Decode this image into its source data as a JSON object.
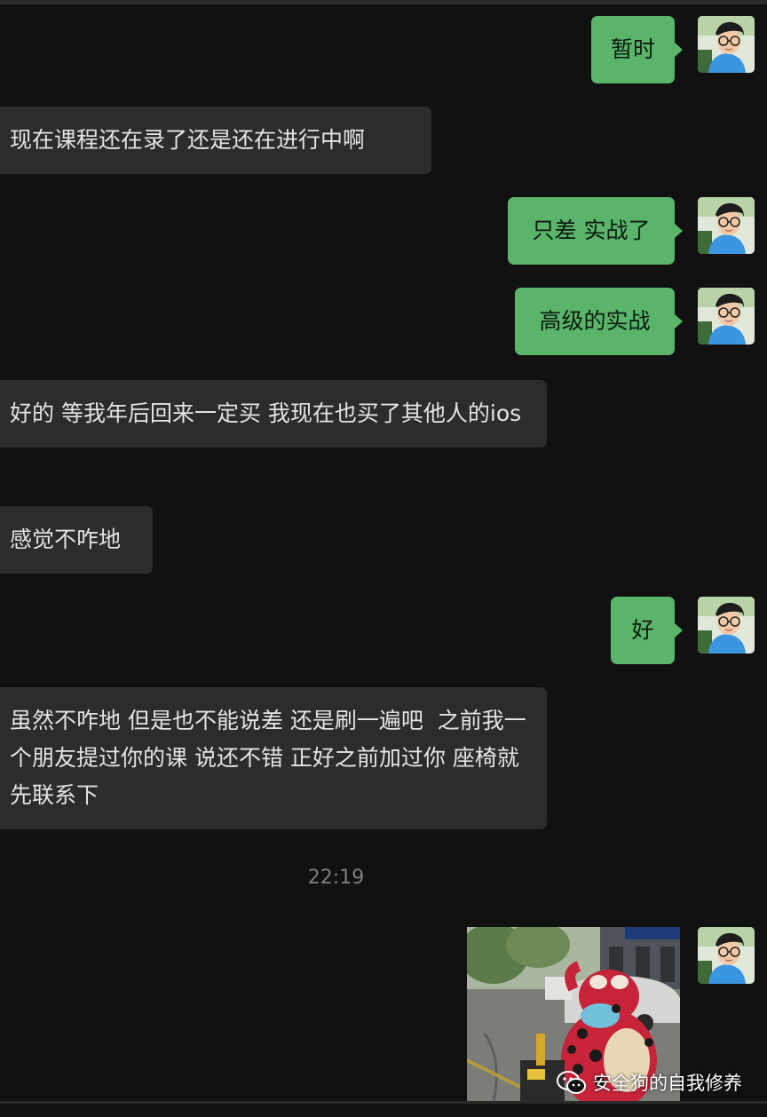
{
  "messages": [
    {
      "side": "out",
      "text": "暂时"
    },
    {
      "side": "in",
      "text": "现在课程还在录了还是还在进行中啊"
    },
    {
      "side": "out",
      "text": "只差 实战了"
    },
    {
      "side": "out",
      "text": "高级的实战"
    },
    {
      "side": "in",
      "text": "好的 等我年后回来一定买 我现在也买了其他人的ios"
    },
    {
      "side": "in",
      "text": "感觉不咋地"
    },
    {
      "side": "out",
      "text": "好"
    },
    {
      "side": "in",
      "text": "虽然不咋地 但是也不能说差 还是刷一遍吧  之前我一个朋友提过你的课 说还不错 正好之前加过你 座椅就先联系下"
    }
  ],
  "timestamp": "22:19",
  "image_message": {
    "side": "out",
    "content": "sticker photo of a red spotted frog mascot costume on a street"
  },
  "watermark": {
    "icon": "wechat-icon",
    "text": "安全狗的自我修养"
  },
  "colors": {
    "background": "#111111",
    "incoming_bubble": "#2c2c2c",
    "outgoing_bubble": "#5ab56b",
    "incoming_text": "#e4e4e4",
    "outgoing_text": "#0b1a0e",
    "timestamp": "#7d7d7d"
  }
}
